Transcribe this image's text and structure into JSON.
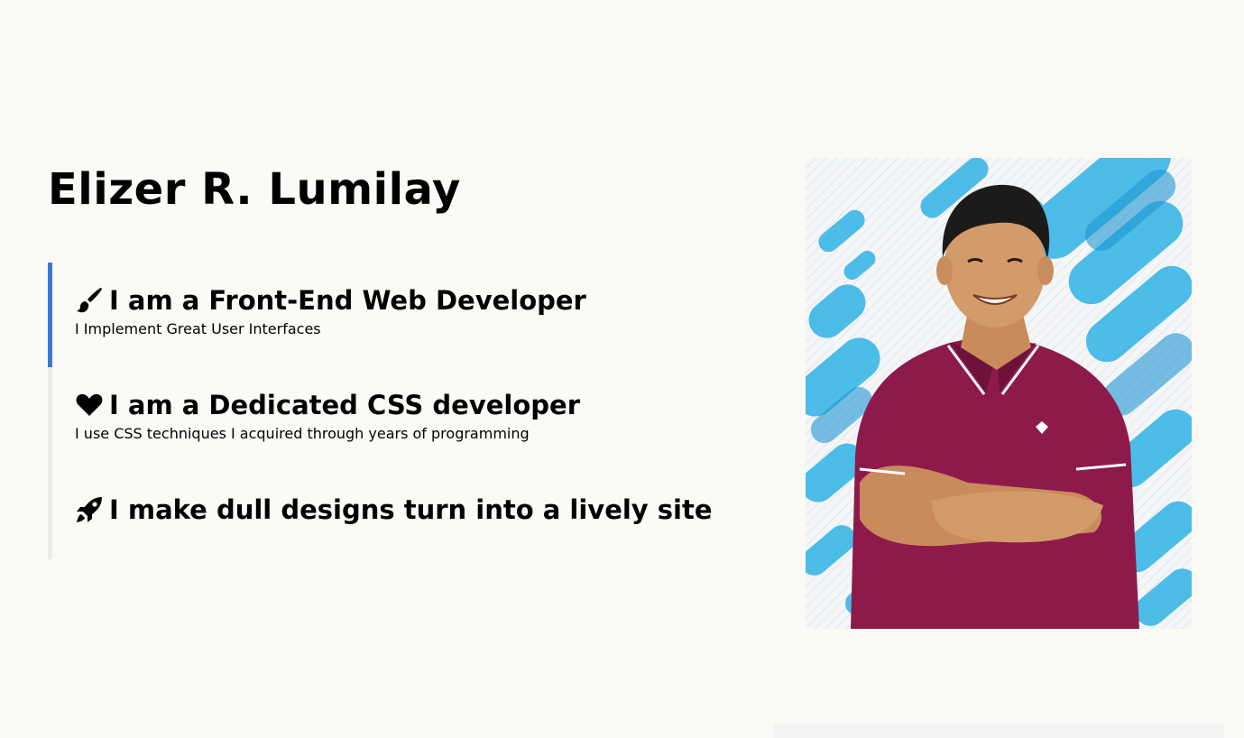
{
  "hero": {
    "name": "Elizer R. Lumilay",
    "features": [
      {
        "icon": "paint-brush-icon",
        "title": "I am a Front-End Web Developer",
        "description": "I Implement Great User Interfaces",
        "active": true
      },
      {
        "icon": "heart-icon",
        "title": "I am a Dedicated CSS developer",
        "description": "I use CSS techniques I acquired through years of programming",
        "active": false
      },
      {
        "icon": "rocket-icon",
        "title": "I make dull designs turn into a lively site",
        "description": "",
        "active": false
      }
    ]
  },
  "colors": {
    "background": "#fbfaf7",
    "accent": "#3b78d8",
    "rail": "#ececec",
    "shirt": "#8e1a4c",
    "pattern_blue": "#2fb3e6"
  }
}
